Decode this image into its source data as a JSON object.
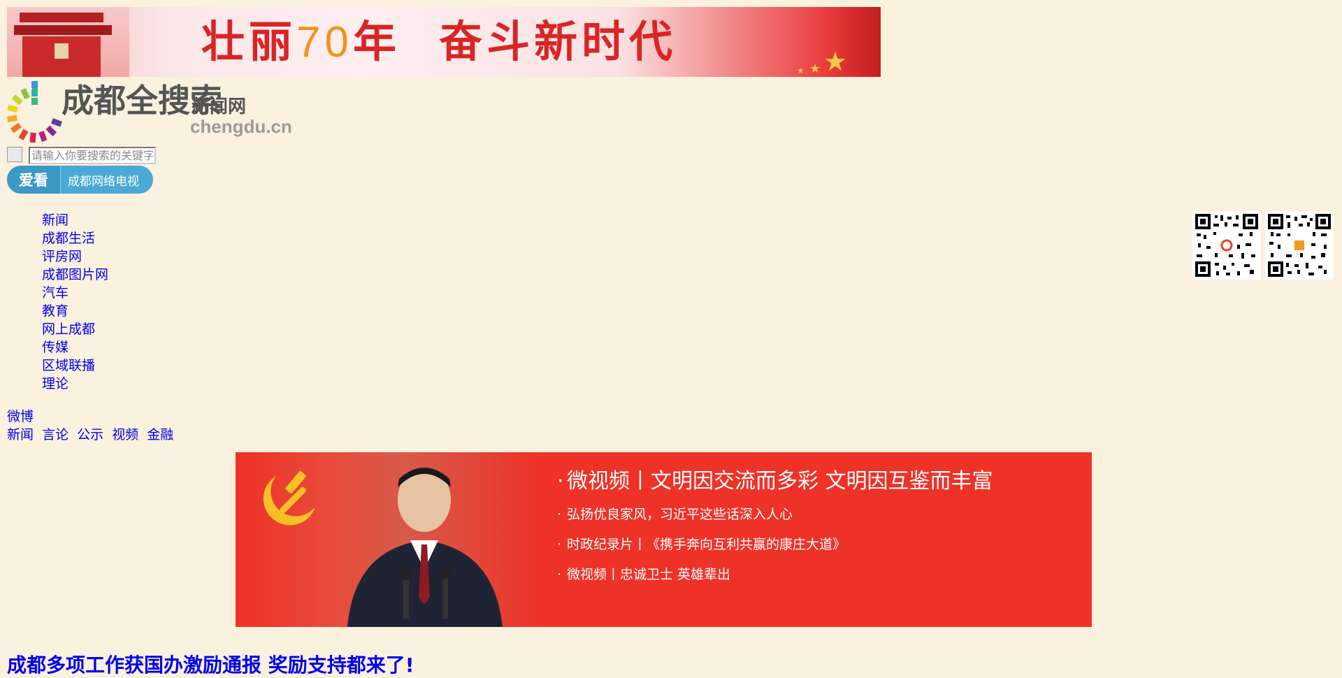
{
  "banner": {
    "text_a": "壮丽",
    "text_num": "70",
    "text_b": "年",
    "text_c": "奋斗新时代"
  },
  "logo": {
    "name": "成都全搜索",
    "suffix": "新闻网",
    "domain": "chengdu.cn"
  },
  "search": {
    "placeholder": "请输入你要搜索的关键字"
  },
  "aikan": {
    "left_label": "爱看",
    "right_label": "成都网络电视"
  },
  "nav": {
    "items": [
      "新闻",
      "成都生活",
      "评房网",
      "成都图片网",
      "汽车",
      "教育",
      "网上成都",
      "传媒",
      "区域联播",
      "理论"
    ]
  },
  "weibo": "微博",
  "subnav": {
    "items": [
      "新闻",
      "言论",
      "公示",
      "视频",
      "金融"
    ]
  },
  "feature": {
    "headline": "微视频丨文明因交流而多彩 文明因互鉴而丰富",
    "items": [
      "弘扬优良家风，习近平这些话深入人心",
      "时政纪录片丨《携手奔向互利共赢的康庄大道》",
      "微视频丨忠诚卫士 英雄辈出"
    ]
  },
  "main_headline": "成都多项工作获国办激励通报 奖励支持都来了!",
  "colors": {
    "page_bg": "#faf1de",
    "link": "#0000ee",
    "feature_bg": "#ee3228",
    "aikan_bg": "#4aa9d5"
  }
}
